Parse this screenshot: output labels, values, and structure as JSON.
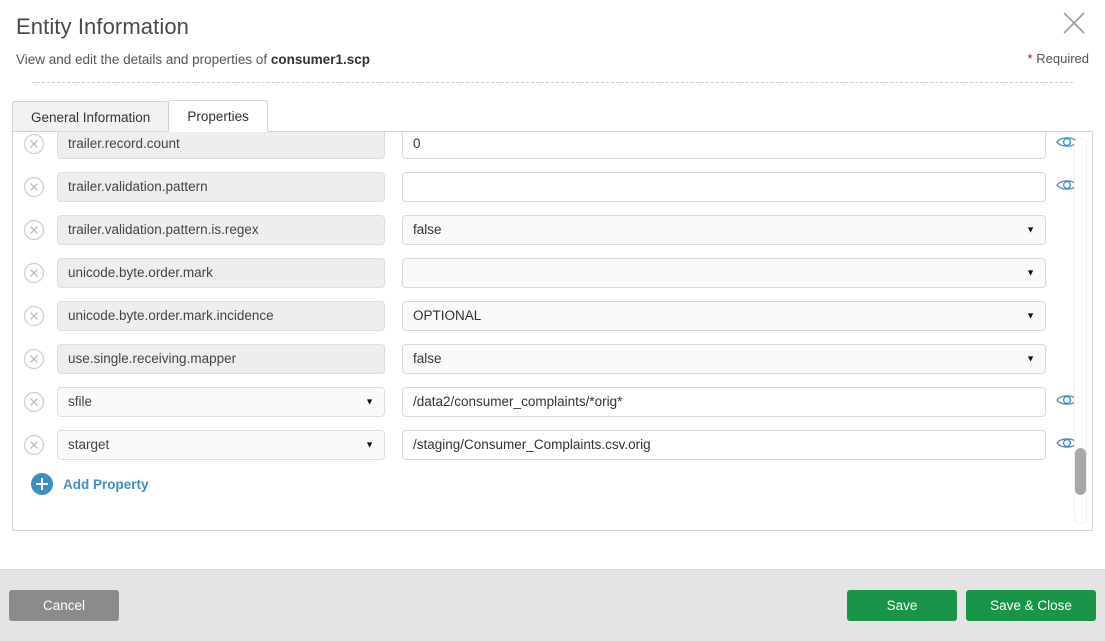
{
  "dialog": {
    "title": "Entity Information",
    "subtitle_prefix": "View and edit the details and properties of ",
    "subtitle_entity": "consumer1.scp",
    "required_star": "*",
    "required_label": "Required",
    "close_icon": "close-icon"
  },
  "tabs": [
    {
      "label": "General Information",
      "active": false
    },
    {
      "label": "Properties",
      "active": true
    }
  ],
  "properties": [
    {
      "name": "trailer.record.count",
      "name_type": "readonly",
      "value": "0",
      "value_type": "text",
      "has_eye": true
    },
    {
      "name": "trailer.validation.pattern",
      "name_type": "readonly",
      "value": "",
      "value_type": "text",
      "has_eye": true
    },
    {
      "name": "trailer.validation.pattern.is.regex",
      "name_type": "readonly",
      "value": "false",
      "value_type": "select",
      "has_eye": false
    },
    {
      "name": "unicode.byte.order.mark",
      "name_type": "readonly",
      "value": "",
      "value_type": "select",
      "has_eye": false
    },
    {
      "name": "unicode.byte.order.mark.incidence",
      "name_type": "readonly",
      "value": "OPTIONAL",
      "value_type": "select",
      "has_eye": false
    },
    {
      "name": "use.single.receiving.mapper",
      "name_type": "readonly",
      "value": "false",
      "value_type": "select",
      "has_eye": false
    },
    {
      "name": "sfile",
      "name_type": "select",
      "value": "/data2/consumer_complaints/*orig*",
      "value_type": "text",
      "has_eye": true
    },
    {
      "name": "starget",
      "name_type": "select",
      "value": "/staging/Consumer_Complaints.csv.orig",
      "value_type": "text",
      "has_eye": true
    }
  ],
  "add_property": {
    "label": "Add Property",
    "icon": "plus-circle-icon"
  },
  "footer": {
    "cancel_label": "Cancel",
    "save_label": "Save",
    "save_close_label": "Save & Close"
  },
  "colors": {
    "accent_blue": "#3d8fc0",
    "save_green": "#1a9447",
    "cancel_gray": "#8b8b8b",
    "required_red": "#d0021b",
    "footer_bg": "#e4e4e4"
  },
  "icons": {
    "delete_row": "remove-circle-icon",
    "reveal_value": "eye-icon",
    "dropdown": "chevron-down-icon"
  }
}
